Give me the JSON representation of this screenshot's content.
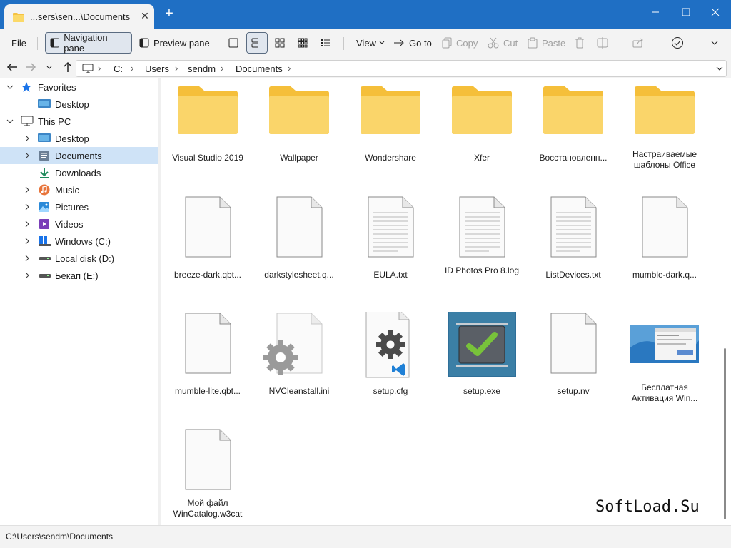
{
  "tab": {
    "title": "...sers\\sen...\\Documents",
    "close": "✕",
    "new": "+"
  },
  "window": {
    "minimize": "—",
    "maximize": "☐",
    "close": "✕"
  },
  "toolbar": {
    "file": "File",
    "navigation_pane": "Navigation pane",
    "preview_pane": "Preview pane",
    "view": "View",
    "goto": "Go to",
    "copy": "Copy",
    "cut": "Cut",
    "paste": "Paste"
  },
  "address": {
    "crumbs": [
      "C:",
      "Users",
      "sendm",
      "Documents"
    ]
  },
  "sidebar": {
    "favorites": "Favorites",
    "fav_desktop": "Desktop",
    "this_pc": "This PC",
    "items": [
      "Desktop",
      "Documents",
      "Downloads",
      "Music",
      "Pictures",
      "Videos",
      "Windows (C:)",
      "Local disk (D:)",
      "Бекап (E:)"
    ]
  },
  "files": {
    "row1": [
      "Visual Studio 2019",
      "Wallpaper",
      "Wondershare",
      "Xfer",
      "Восстановленн...",
      "Настраиваемые шаблоны Office"
    ],
    "row2": [
      "breeze-dark.qbt...",
      "darkstylesheet.q...",
      "EULA.txt",
      "ID Photos Pro 8.log",
      "ListDevices.txt",
      "mumble-dark.q..."
    ],
    "row3": [
      "mumble-lite.qbt...",
      "NVCleanstall.ini",
      "setup.cfg",
      "setup.exe",
      "setup.nv",
      "Бесплатная Активация Win..."
    ],
    "row4": [
      "Мой файл WinCatalog.w3cat"
    ]
  },
  "status": {
    "path": "C:\\Users\\sendm\\Documents"
  },
  "watermark": "SoftLoad.Su",
  "colors": {
    "titlebar": "#1f6fc4",
    "folder": "#f9cf5a",
    "selection": "#cfe3f7"
  }
}
